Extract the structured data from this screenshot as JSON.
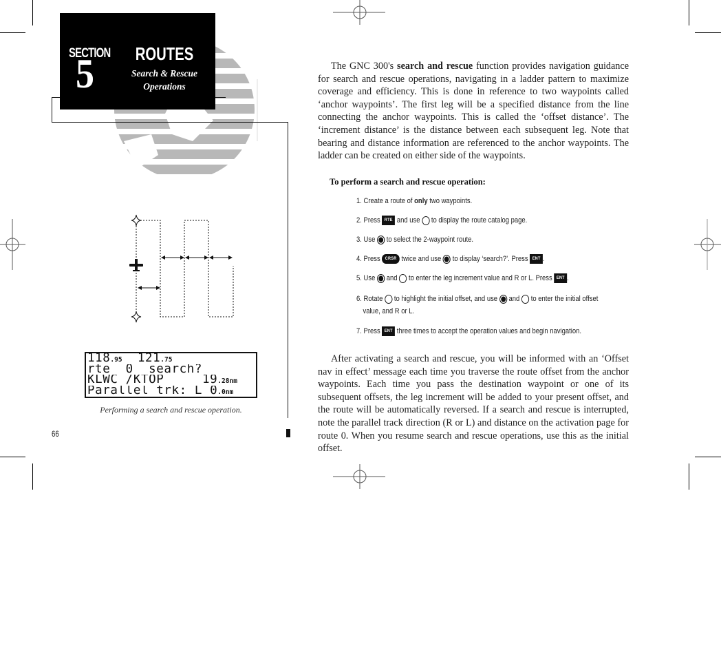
{
  "header": {
    "section_label": "SECTION",
    "section_number": "5",
    "title": "ROUTES",
    "subtitle_line1": "Search & Rescue",
    "subtitle_line2": "Operations"
  },
  "page_number": "66",
  "figure": {
    "caption": "Performing a search and rescue operation.",
    "lcd_lines": [
      {
        "parts": [
          {
            "t": "118",
            "s": false
          },
          {
            "t": ".95",
            "s": true
          },
          {
            "t": "  121",
            "s": false
          },
          {
            "t": ".75",
            "s": true
          }
        ]
      },
      {
        "parts": [
          {
            "t": "rte  0  search?",
            "s": false
          }
        ]
      },
      {
        "parts": [
          {
            "t": "KLWC /KTOP     19",
            "s": false
          },
          {
            "t": ".28",
            "s": true
          },
          {
            "t": "nm",
            "s": true
          }
        ]
      },
      {
        "parts": [
          {
            "t": "Parallel trk: L 0",
            "s": false
          },
          {
            "t": ".0",
            "s": true
          },
          {
            "t": "nm",
            "s": true
          }
        ]
      }
    ]
  },
  "intro": {
    "before_bold": "The GNC 300's ",
    "bold": "search and rescue",
    "after_bold": " function provides navigation guidance for search and rescue operations, navigating in a ladder pattern to maximize coverage and efficiency. This is done in reference to two waypoints called ‘anchor waypoints’. The first leg will be a specified distance from the line connecting the anchor waypoints. This is called the ‘offset distance’. The ‘increment distance’ is the distance between each subsequent leg. Note that bearing and distance information are referenced to the anchor waypoints. The ladder can be created on either side of the waypoints."
  },
  "procedure": {
    "heading": "To perform a search and rescue operation:",
    "steps": [
      {
        "n": "1.",
        "parts": [
          {
            "type": "text",
            "v": "Create a route of "
          },
          {
            "type": "bold",
            "v": "only"
          },
          {
            "type": "text",
            "v": " two waypoints."
          }
        ]
      },
      {
        "n": "2.",
        "parts": [
          {
            "type": "text",
            "v": "Press "
          },
          {
            "type": "key",
            "v": "RTE"
          },
          {
            "type": "text",
            "v": " and use "
          },
          {
            "type": "knob-outer",
            "v": "outer-knob-icon"
          },
          {
            "type": "text",
            "v": " to display the route catalog page."
          }
        ]
      },
      {
        "n": "3.",
        "parts": [
          {
            "type": "text",
            "v": "Use "
          },
          {
            "type": "knob-inner",
            "v": "inner-knob-icon"
          },
          {
            "type": "text",
            "v": " to select the 2-waypoint route."
          }
        ]
      },
      {
        "n": "4.",
        "parts": [
          {
            "type": "text",
            "v": "Press "
          },
          {
            "type": "key-pill",
            "v": "CRSR"
          },
          {
            "type": "text",
            "v": " twice and use "
          },
          {
            "type": "knob-inner",
            "v": "inner-knob-icon"
          },
          {
            "type": "text",
            "v": " to display ‘search?’. Press "
          },
          {
            "type": "key",
            "v": "ENT"
          },
          {
            "type": "text",
            "v": "."
          }
        ]
      },
      {
        "n": "5.",
        "parts": [
          {
            "type": "text",
            "v": "Use "
          },
          {
            "type": "knob-inner",
            "v": "inner-knob-icon"
          },
          {
            "type": "text",
            "v": " and "
          },
          {
            "type": "knob-outer",
            "v": "outer-knob-icon"
          },
          {
            "type": "text",
            "v": " to enter the leg increment value and R or L. Press "
          },
          {
            "type": "key",
            "v": "ENT"
          },
          {
            "type": "text",
            "v": "."
          }
        ]
      },
      {
        "n": "6.",
        "parts": [
          {
            "type": "text",
            "v": "Rotate "
          },
          {
            "type": "knob-outer",
            "v": "outer-knob-icon"
          },
          {
            "type": "text",
            "v": " to highlight the initial offset, and use "
          },
          {
            "type": "knob-inner",
            "v": "inner-knob-icon"
          },
          {
            "type": "text",
            "v": " and "
          },
          {
            "type": "knob-outer",
            "v": "outer-knob-icon"
          },
          {
            "type": "text",
            "v": " to enter the initial offset"
          }
        ],
        "continuation": "value, and R or L."
      },
      {
        "n": "7.",
        "parts": [
          {
            "type": "text",
            "v": "Press "
          },
          {
            "type": "key",
            "v": "ENT"
          },
          {
            "type": "text",
            "v": " three times to accept the operation values and begin navigation."
          }
        ]
      }
    ]
  },
  "closing": {
    "text": "After activating a search and rescue, you will be informed with an ‘Offset nav in effect’ message each time you traverse the route offset from the anchor waypoints. Each time you pass the destination waypoint or one of its subsequent offsets, the leg increment will be added to your present offset, and the route will be automatically reversed. If a search and rescue is interrupted, note the parallel track direction (R or L) and distance on the activation page for route 0. When you resume search and rescue operations, use this as the initial offset."
  },
  "colors": {
    "globe_gray": "#b8b8b8",
    "ink": "#111111"
  }
}
